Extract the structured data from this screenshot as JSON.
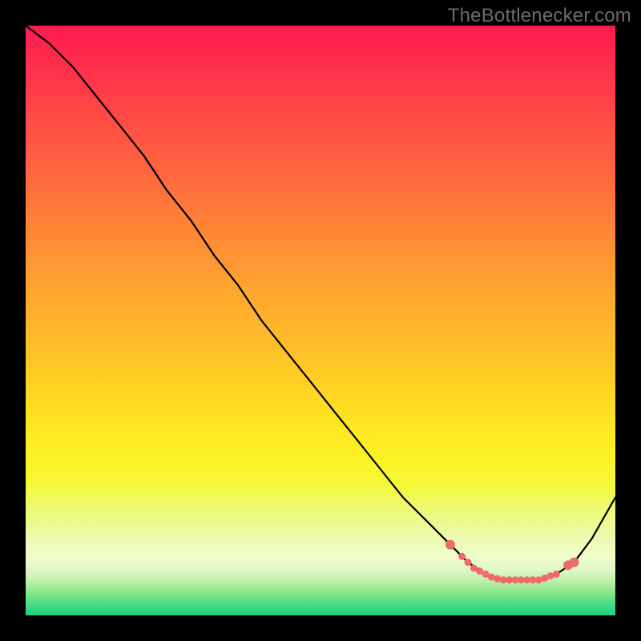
{
  "watermark": "TheBottlenecker.com",
  "chart_data": {
    "type": "line",
    "title": "",
    "xlabel": "",
    "ylabel": "",
    "xlim": [
      0,
      100
    ],
    "ylim": [
      0,
      100
    ],
    "curve": {
      "name": "bottleneck-curve",
      "x": [
        0,
        4,
        8,
        12,
        16,
        20,
        24,
        28,
        32,
        36,
        40,
        44,
        48,
        52,
        56,
        60,
        64,
        68,
        72,
        75,
        78,
        81,
        84,
        87,
        90,
        93,
        96,
        100
      ],
      "y": [
        100,
        97,
        93,
        88,
        83,
        78,
        72,
        67,
        61,
        56,
        50,
        45,
        40,
        35,
        30,
        25,
        20,
        16,
        12,
        9,
        7,
        6,
        6,
        6,
        7,
        9,
        13,
        20
      ]
    },
    "optimal_markers": {
      "name": "optimal-range",
      "color": "#ef6b6b",
      "points": [
        {
          "x": 72,
          "y": 12
        },
        {
          "x": 74,
          "y": 10
        },
        {
          "x": 75,
          "y": 9
        },
        {
          "x": 76,
          "y": 8
        },
        {
          "x": 77,
          "y": 7.5
        },
        {
          "x": 78,
          "y": 7
        },
        {
          "x": 79,
          "y": 6.5
        },
        {
          "x": 80,
          "y": 6.2
        },
        {
          "x": 81,
          "y": 6
        },
        {
          "x": 82,
          "y": 6
        },
        {
          "x": 83,
          "y": 6
        },
        {
          "x": 84,
          "y": 6
        },
        {
          "x": 85,
          "y": 6
        },
        {
          "x": 86,
          "y": 6
        },
        {
          "x": 87,
          "y": 6
        },
        {
          "x": 88,
          "y": 6.3
        },
        {
          "x": 89,
          "y": 6.7
        },
        {
          "x": 90,
          "y": 7
        },
        {
          "x": 92,
          "y": 8.5
        },
        {
          "x": 93,
          "y": 9
        }
      ]
    },
    "gradient_stops": [
      {
        "pos": 0,
        "color": "#ff1a52"
      },
      {
        "pos": 50,
        "color": "#ffc228"
      },
      {
        "pos": 75,
        "color": "#fbf325"
      },
      {
        "pos": 100,
        "color": "#1fd083"
      }
    ]
  }
}
